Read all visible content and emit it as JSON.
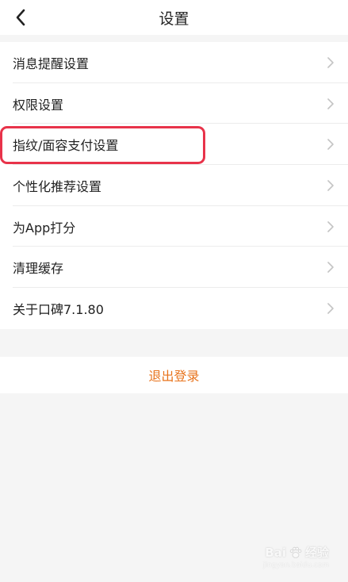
{
  "navbar": {
    "title": "设置",
    "back_icon": "chevron-left-icon"
  },
  "menu": {
    "items": [
      {
        "label": "消息提醒设置",
        "icon": "chevron-right-icon"
      },
      {
        "label": "权限设置",
        "icon": "chevron-right-icon"
      },
      {
        "label": "指纹/面容支付设置",
        "icon": "chevron-right-icon"
      },
      {
        "label": "个性化推荐设置",
        "icon": "chevron-right-icon"
      },
      {
        "label": "为App打分",
        "icon": "chevron-right-icon"
      },
      {
        "label": "清理缓存",
        "icon": "chevron-right-icon"
      },
      {
        "label": "关于口碑7.1.80",
        "icon": "chevron-right-icon"
      }
    ],
    "highlighted_item": "指纹/面容支付设置"
  },
  "logout": {
    "label": "退出登录"
  },
  "watermark": {
    "brand": "Bai",
    "brand_suffix": "经验",
    "url": "jingyan.baidu.com",
    "icon": "paw-logo-icon"
  },
  "colors": {
    "accent": "#e8741e",
    "highlight": "#e8334a",
    "text": "#222222",
    "chevron": "#c4c4c4",
    "background": "#f5f5f5"
  }
}
